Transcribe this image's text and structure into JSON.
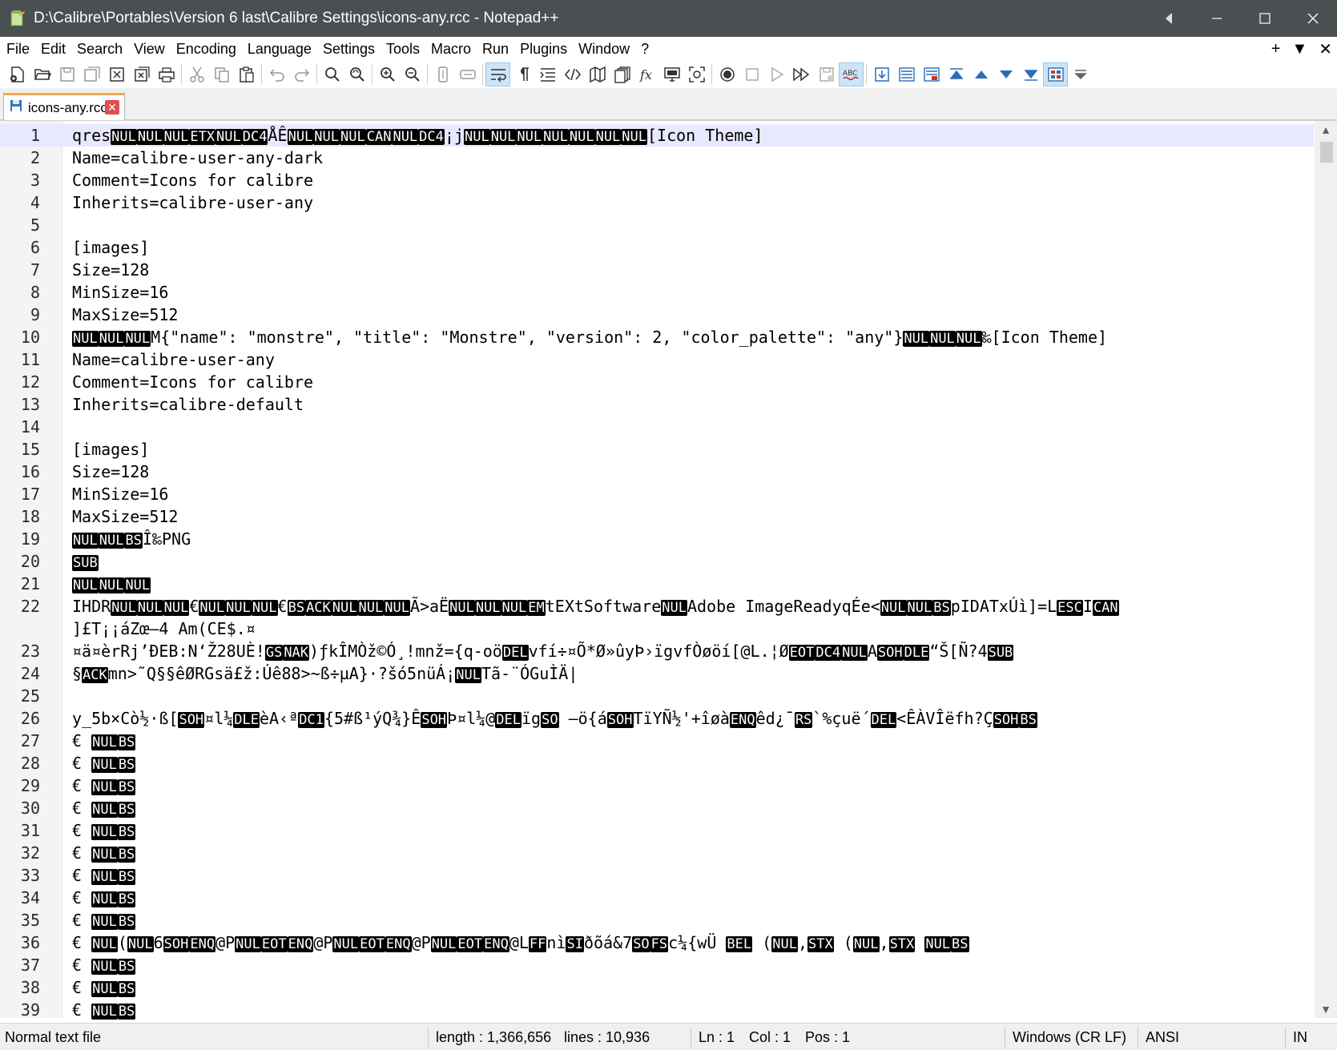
{
  "window": {
    "title": "D:\\Calibre\\Portables\\Version 6 last\\Calibre Settings\\icons-any.rcc - Notepad++"
  },
  "menu": {
    "items": [
      "File",
      "Edit",
      "Search",
      "View",
      "Encoding",
      "Language",
      "Settings",
      "Tools",
      "Macro",
      "Run",
      "Plugins",
      "Window",
      "?"
    ],
    "right": [
      "+",
      "▼",
      "✕"
    ]
  },
  "toolbar": {
    "icons": [
      "new-file-icon",
      "open-file-icon",
      "save-icon",
      "save-all-icon",
      "close-icon",
      "close-all-icon",
      "print-icon",
      "cut-icon",
      "copy-icon",
      "paste-icon",
      "undo-icon",
      "redo-icon",
      "find-icon",
      "replace-icon",
      "zoom-in-icon",
      "zoom-out-icon",
      "sync-vertical-icon",
      "sync-horizontal-icon",
      "word-wrap-icon",
      "show-all-characters-icon",
      "indent-guide-icon",
      "xml-tag-icon",
      "document-map-icon",
      "document-list-icon",
      "function-list-icon",
      "monitoring-icon",
      "focus-mode-icon",
      "record-macro-icon",
      "stop-macro-icon",
      "play-macro-icon",
      "run-macro-multiple-icon",
      "save-macro-icon",
      "spell-check-icon"
    ]
  },
  "tab": {
    "label": "icons-any.rcc"
  },
  "editor": {
    "lines": [
      {
        "n": "1",
        "parts": [
          [
            "t",
            "qres"
          ],
          [
            "c",
            "NUL"
          ],
          [
            "c",
            "NUL"
          ],
          [
            "c",
            "NUL"
          ],
          [
            "c",
            "ETX"
          ],
          [
            "c",
            "NUL"
          ],
          [
            "c",
            "DC4"
          ],
          [
            "t",
            "ÅÊ"
          ],
          [
            "c",
            "NUL"
          ],
          [
            "c",
            "NUL"
          ],
          [
            "c",
            "NUL"
          ],
          [
            "c",
            "CAN"
          ],
          [
            "c",
            "NUL"
          ],
          [
            "c",
            "DC4"
          ],
          [
            "t",
            "¡j"
          ],
          [
            "c",
            "NUL"
          ],
          [
            "c",
            "NUL"
          ],
          [
            "c",
            "NUL"
          ],
          [
            "c",
            "NUL"
          ],
          [
            "c",
            "NUL"
          ],
          [
            "c",
            "NUL"
          ],
          [
            "c",
            "NUL"
          ],
          [
            "t",
            "[Icon Theme]"
          ]
        ]
      },
      {
        "n": "2",
        "parts": [
          [
            "t",
            "Name=calibre-user-any-dark"
          ]
        ]
      },
      {
        "n": "3",
        "parts": [
          [
            "t",
            "Comment=Icons for calibre"
          ]
        ]
      },
      {
        "n": "4",
        "parts": [
          [
            "t",
            "Inherits=calibre-user-any"
          ]
        ]
      },
      {
        "n": "5",
        "parts": []
      },
      {
        "n": "6",
        "parts": [
          [
            "t",
            "[images]"
          ]
        ]
      },
      {
        "n": "7",
        "parts": [
          [
            "t",
            "Size=128"
          ]
        ]
      },
      {
        "n": "8",
        "parts": [
          [
            "t",
            "MinSize=16"
          ]
        ]
      },
      {
        "n": "9",
        "parts": [
          [
            "t",
            "MaxSize=512"
          ]
        ]
      },
      {
        "n": "10",
        "parts": [
          [
            "c",
            "NUL"
          ],
          [
            "c",
            "NUL"
          ],
          [
            "c",
            "NUL"
          ],
          [
            "t",
            "M{\"name\": \"monstre\", \"title\": \"Monstre\", \"version\": 2, \"color_palette\": \"any\"}"
          ],
          [
            "c",
            "NUL"
          ],
          [
            "c",
            "NUL"
          ],
          [
            "c",
            "NUL"
          ],
          [
            "t",
            "‰[Icon Theme]"
          ]
        ]
      },
      {
        "n": "11",
        "parts": [
          [
            "t",
            "Name=calibre-user-any"
          ]
        ]
      },
      {
        "n": "12",
        "parts": [
          [
            "t",
            "Comment=Icons for calibre"
          ]
        ]
      },
      {
        "n": "13",
        "parts": [
          [
            "t",
            "Inherits=calibre-default"
          ]
        ]
      },
      {
        "n": "14",
        "parts": []
      },
      {
        "n": "15",
        "parts": [
          [
            "t",
            "[images]"
          ]
        ]
      },
      {
        "n": "16",
        "parts": [
          [
            "t",
            "Size=128"
          ]
        ]
      },
      {
        "n": "17",
        "parts": [
          [
            "t",
            "MinSize=16"
          ]
        ]
      },
      {
        "n": "18",
        "parts": [
          [
            "t",
            "MaxSize=512"
          ]
        ]
      },
      {
        "n": "19",
        "parts": [
          [
            "c",
            "NUL"
          ],
          [
            "c",
            "NUL"
          ],
          [
            "c",
            "BS"
          ],
          [
            "t",
            "Î‰PNG"
          ]
        ]
      },
      {
        "n": "20",
        "parts": [
          [
            "c",
            "SUB"
          ]
        ]
      },
      {
        "n": "21",
        "parts": [
          [
            "c",
            "NUL"
          ],
          [
            "c",
            "NUL"
          ],
          [
            "c",
            "NUL"
          ]
        ]
      },
      {
        "n": "22",
        "parts": [
          [
            "t",
            "IHDR"
          ],
          [
            "c",
            "NUL"
          ],
          [
            "c",
            "NUL"
          ],
          [
            "c",
            "NUL"
          ],
          [
            "t",
            "€"
          ],
          [
            "c",
            "NUL"
          ],
          [
            "c",
            "NUL"
          ],
          [
            "c",
            "NUL"
          ],
          [
            "t",
            "€"
          ],
          [
            "c",
            "BS"
          ],
          [
            "c",
            "ACK"
          ],
          [
            "c",
            "NUL"
          ],
          [
            "c",
            "NUL"
          ],
          [
            "c",
            "NUL"
          ],
          [
            "t",
            "Ã>aË"
          ],
          [
            "c",
            "NUL"
          ],
          [
            "c",
            "NUL"
          ],
          [
            "c",
            "NUL"
          ],
          [
            "c",
            "EM"
          ],
          [
            "t",
            "tEXtSoftware"
          ],
          [
            "c",
            "NUL"
          ],
          [
            "t",
            "Adobe ImageReadyqÉe<"
          ],
          [
            "c",
            "NUL"
          ],
          [
            "c",
            "NUL"
          ],
          [
            "c",
            "BS"
          ],
          [
            "t",
            "pIDATxÚì]=L"
          ],
          [
            "c",
            "ESC"
          ],
          [
            "t",
            "I"
          ],
          [
            "c",
            "CAN"
          ]
        ]
      },
      {
        "n": "",
        "parts": [
          [
            "t",
            "]£T¡¡áZœ–4 Am(CE$.¤"
          ]
        ]
      },
      {
        "n": "23",
        "parts": [
          [
            "t",
            "¤ä¤èrRj’ÐEB:N‘Ž28UÈ!"
          ],
          [
            "c",
            "GS"
          ],
          [
            "c",
            "NAK"
          ],
          [
            "t",
            ")ƒkÎMÒž©Ó¸!mnž={q-oö"
          ],
          [
            "c",
            "DEL"
          ],
          [
            "t",
            "vfí÷¤Õ*Ø»ûyÞ›ïgvfÒøöí[@L.¦Ø"
          ],
          [
            "c",
            "EOT"
          ],
          [
            "c",
            "DC4"
          ],
          [
            "c",
            "NUL"
          ],
          [
            "t",
            "A"
          ],
          [
            "c",
            "SOH"
          ],
          [
            "c",
            "DLE"
          ],
          [
            "t",
            "“Š[Ñ?4"
          ],
          [
            "c",
            "SUB"
          ]
        ]
      },
      {
        "n": "24",
        "parts": [
          [
            "t",
            "§"
          ],
          [
            "c",
            "ACK"
          ],
          [
            "t",
            "mn>˜Q§§êØRGsä£ž:Úê88>~ß÷µA}·?šó5nüÁ¡"
          ],
          [
            "c",
            "NUL"
          ],
          [
            "t",
            "Tã-¨ÓGuÌÄ|"
          ]
        ]
      },
      {
        "n": "25",
        "parts": []
      },
      {
        "n": "26",
        "parts": [
          [
            "t",
            "y_5b×Cò½·ß["
          ],
          [
            "c",
            "SOH"
          ],
          [
            "t",
            "¤l¼"
          ],
          [
            "c",
            "DLE"
          ],
          [
            "t",
            "èA‹ª"
          ],
          [
            "c",
            "DC1"
          ],
          [
            "t",
            "{5#ß¹ýQ¾}Ê"
          ],
          [
            "c",
            "SOH"
          ],
          [
            "t",
            "Þ¤l¼@"
          ],
          [
            "c",
            "DEL"
          ],
          [
            "t",
            "ïg"
          ],
          [
            "c",
            "SO"
          ],
          [
            "t",
            " –ö{á"
          ],
          [
            "c",
            "SOH"
          ],
          [
            "t",
            "TïYÑ½'+îøà"
          ],
          [
            "c",
            "ENQ"
          ],
          [
            "t",
            "êd¿¯"
          ],
          [
            "c",
            "RS"
          ],
          [
            "t",
            "`%çuë´"
          ],
          [
            "c",
            "DEL"
          ],
          [
            "t",
            "<ÊÀVÎëfh?Ç"
          ],
          [
            "c",
            "SOH"
          ],
          [
            "c",
            "BS"
          ]
        ]
      },
      {
        "n": "27",
        "parts": [
          [
            "t",
            "€ "
          ],
          [
            "c",
            "NUL"
          ],
          [
            "c",
            "BS"
          ]
        ]
      },
      {
        "n": "28",
        "parts": [
          [
            "t",
            "€ "
          ],
          [
            "c",
            "NUL"
          ],
          [
            "c",
            "BS"
          ]
        ]
      },
      {
        "n": "29",
        "parts": [
          [
            "t",
            "€ "
          ],
          [
            "c",
            "NUL"
          ],
          [
            "c",
            "BS"
          ]
        ]
      },
      {
        "n": "30",
        "parts": [
          [
            "t",
            "€ "
          ],
          [
            "c",
            "NUL"
          ],
          [
            "c",
            "BS"
          ]
        ]
      },
      {
        "n": "31",
        "parts": [
          [
            "t",
            "€ "
          ],
          [
            "c",
            "NUL"
          ],
          [
            "c",
            "BS"
          ]
        ]
      },
      {
        "n": "32",
        "parts": [
          [
            "t",
            "€ "
          ],
          [
            "c",
            "NUL"
          ],
          [
            "c",
            "BS"
          ]
        ]
      },
      {
        "n": "33",
        "parts": [
          [
            "t",
            "€ "
          ],
          [
            "c",
            "NUL"
          ],
          [
            "c",
            "BS"
          ]
        ]
      },
      {
        "n": "34",
        "parts": [
          [
            "t",
            "€ "
          ],
          [
            "c",
            "NUL"
          ],
          [
            "c",
            "BS"
          ]
        ]
      },
      {
        "n": "35",
        "parts": [
          [
            "t",
            "€ "
          ],
          [
            "c",
            "NUL"
          ],
          [
            "c",
            "BS"
          ]
        ]
      },
      {
        "n": "36",
        "parts": [
          [
            "t",
            "€ "
          ],
          [
            "c",
            "NUL"
          ],
          [
            "t",
            "("
          ],
          [
            "c",
            "NUL"
          ],
          [
            "t",
            "6"
          ],
          [
            "c",
            "SOH"
          ],
          [
            "c",
            "ENQ"
          ],
          [
            "t",
            "@P"
          ],
          [
            "c",
            "NUL"
          ],
          [
            "c",
            "EOT"
          ],
          [
            "c",
            "ENQ"
          ],
          [
            "t",
            "@P"
          ],
          [
            "c",
            "NUL"
          ],
          [
            "c",
            "EOT"
          ],
          [
            "c",
            "ENQ"
          ],
          [
            "t",
            "@P"
          ],
          [
            "c",
            "NUL"
          ],
          [
            "c",
            "EOT"
          ],
          [
            "c",
            "ENQ"
          ],
          [
            "t",
            "@L"
          ],
          [
            "c",
            "FF"
          ],
          [
            "t",
            "nì"
          ],
          [
            "c",
            "SI"
          ],
          [
            "t",
            "ðõá&7"
          ],
          [
            "c",
            "SO"
          ],
          [
            "c",
            "FS"
          ],
          [
            "t",
            "c¼{wÜ "
          ],
          [
            "c",
            "BEL"
          ],
          [
            "t",
            " ("
          ],
          [
            "c",
            "NUL"
          ],
          [
            "t",
            ","
          ],
          [
            "c",
            "STX"
          ],
          [
            "t",
            " ("
          ],
          [
            "c",
            "NUL"
          ],
          [
            "t",
            ","
          ],
          [
            "c",
            "STX"
          ],
          [
            "t",
            " "
          ],
          [
            "c",
            "NUL"
          ],
          [
            "c",
            "BS"
          ]
        ]
      },
      {
        "n": "37",
        "parts": [
          [
            "t",
            "€ "
          ],
          [
            "c",
            "NUL"
          ],
          [
            "c",
            "BS"
          ]
        ]
      },
      {
        "n": "38",
        "parts": [
          [
            "t",
            "€ "
          ],
          [
            "c",
            "NUL"
          ],
          [
            "c",
            "BS"
          ]
        ]
      },
      {
        "n": "39",
        "parts": [
          [
            "t",
            "€ "
          ],
          [
            "c",
            "NUL"
          ],
          [
            "c",
            "BS"
          ]
        ]
      }
    ]
  },
  "status": {
    "type": "Normal text file",
    "length": "length : 1,366,656",
    "lines": "lines : 10,936",
    "ln": "Ln : 1",
    "col": "Col : 1",
    "pos": "Pos : 1",
    "eol": "Windows (CR LF)",
    "encoding": "ANSI",
    "mode": "IN"
  }
}
